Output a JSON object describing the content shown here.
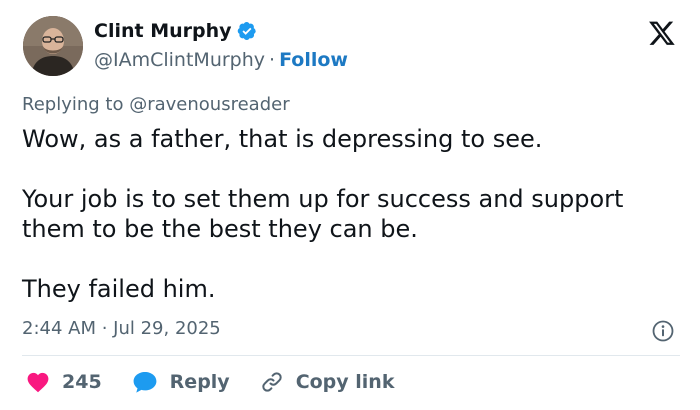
{
  "author": {
    "display_name": "Clint Murphy",
    "handle": "@IAmClintMurphy",
    "separator": "·",
    "follow_label": "Follow",
    "verified": true
  },
  "reply_context": {
    "prefix": "Replying to",
    "mention": "@ravenousreader"
  },
  "tweet": {
    "paragraphs": [
      "Wow, as a father, that is depressing to see.",
      "Your job is to set them up for success and support them to be the best they can be.",
      "They failed him."
    ],
    "timestamp": "2:44 AM · Jul 29, 2025"
  },
  "actions": {
    "like_count": "245",
    "reply_label": "Reply",
    "copy_link_label": "Copy link"
  },
  "icons": {
    "brand": "x-logo-icon",
    "info": "info-icon",
    "like": "heart-icon",
    "reply": "speech-bubble-icon",
    "copy": "link-icon",
    "verified": "verified-badge-icon"
  },
  "colors": {
    "text_primary": "#0f1419",
    "text_secondary": "#536471",
    "link_blue": "#1d79c3",
    "verified_blue": "#1d9bf0",
    "like_red": "#f91880",
    "divider": "#e1e8ed"
  }
}
